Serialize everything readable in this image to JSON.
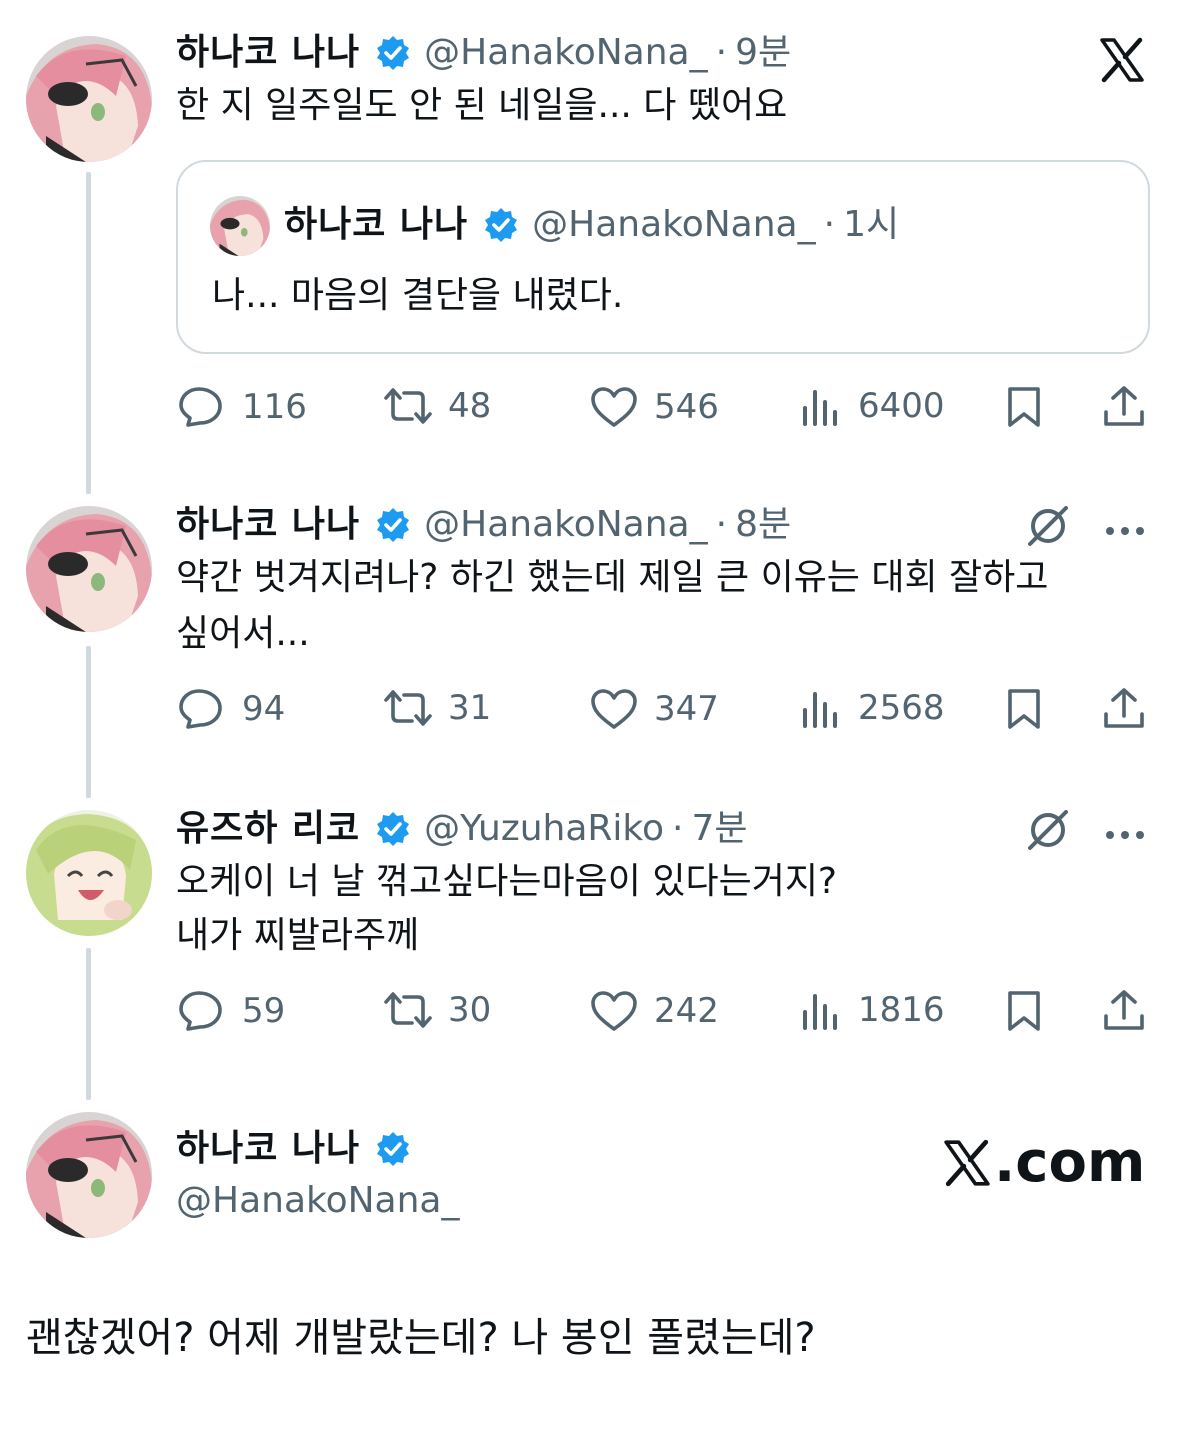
{
  "brand": {
    "color_text": "#0f1419",
    "color_muted": "#536471",
    "color_verified": "#1d9bf0",
    "color_line": "#cfd9de"
  },
  "top_logo": "x-logo",
  "tweets": [
    {
      "name": "하나코 나나",
      "handle": "@HanakoNana_",
      "time": "9분",
      "text": "한 지 일주일도 안 된 네일을... 다 뗐어요",
      "quote": {
        "name": "하나코 나나",
        "handle": "@HanakoNana_",
        "time": "1시",
        "text": "나... 마음의 결단을 내렸다."
      },
      "actions": {
        "replies": "116",
        "retweets": "48",
        "likes": "546",
        "views": "6400"
      }
    },
    {
      "name": "하나코 나나",
      "handle": "@HanakoNana_",
      "time": "8분",
      "text_line1": "약간 벗겨지려나? 하긴 했는데 제일 큰 이유는 대회 잘하고",
      "text_line2": "싶어서...",
      "actions": {
        "replies": "94",
        "retweets": "31",
        "likes": "347",
        "views": "2568"
      }
    },
    {
      "name": "유즈하 리코",
      "handle": "@YuzuhaRiko",
      "time": "7분",
      "text_line1": "오케이 너 날 꺾고싶다는마음이 있다는거지?",
      "text_line2": "내가 찌발라주께",
      "actions": {
        "replies": "59",
        "retweets": "30",
        "likes": "242",
        "views": "1816"
      }
    }
  ],
  "profile_card": {
    "name": "하나코 나나",
    "handle": "@HanakoNana_",
    "site": ".com"
  },
  "caption": "괜찮겠어? 어제 개발랐는데? 나 봉인 풀렸는데?"
}
